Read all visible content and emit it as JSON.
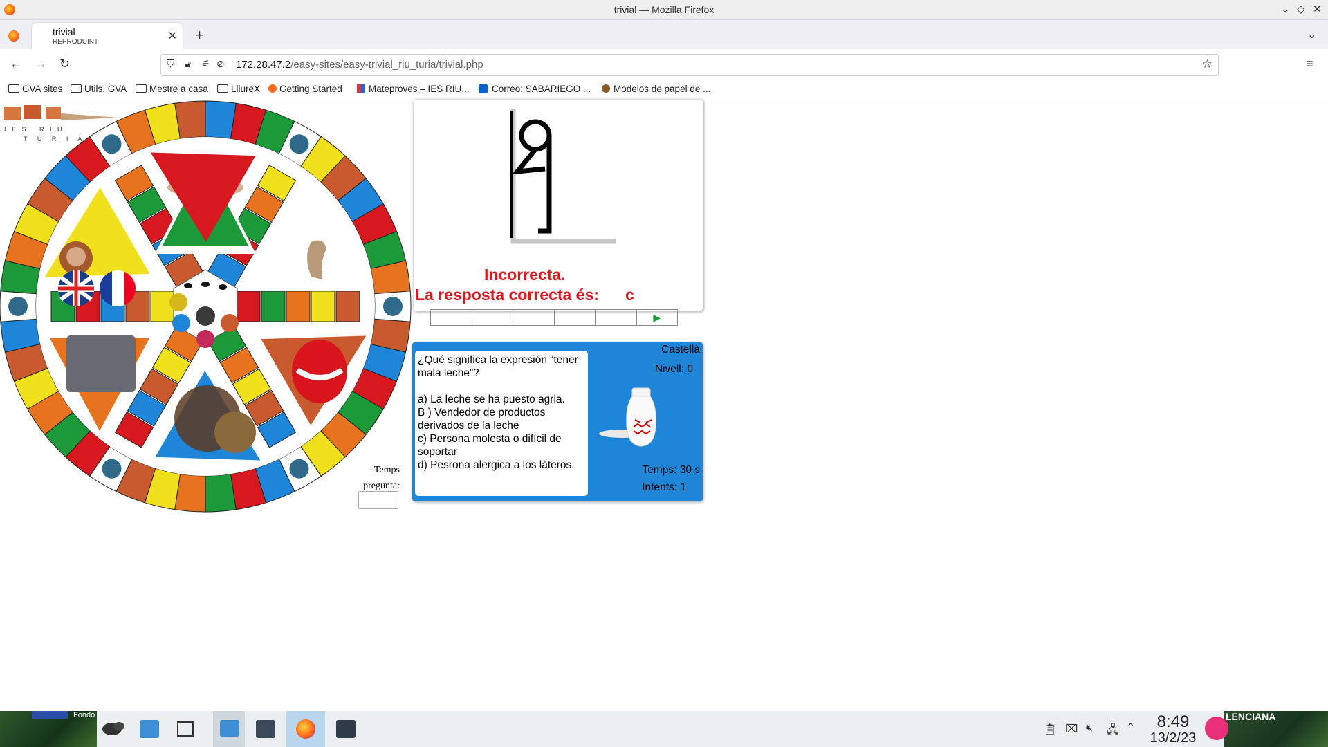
{
  "window": {
    "title": "trivial — Mozilla Firefox"
  },
  "tab": {
    "title": "trivial",
    "subtitle": "REPRODUINT"
  },
  "address": {
    "host": "172.28.47.2",
    "path": "/easy-sites/easy-trivial_riu_turia/trivial.php"
  },
  "bookmarks": [
    {
      "label": "GVA sites",
      "icon": "folder-icon"
    },
    {
      "label": "Utils. GVA",
      "icon": "folder-icon"
    },
    {
      "label": "Mestre a casa",
      "icon": "folder-icon"
    },
    {
      "label": "LliureX",
      "icon": "folder-icon"
    },
    {
      "label": "Getting Started",
      "icon": "firefox-icon"
    },
    {
      "label": "Mateproves – IES RIU...",
      "icon": "site-icon"
    },
    {
      "label": "Correo: SABARIEGO ...",
      "icon": "outlook-icon"
    },
    {
      "label": "Modelos de papel de ...",
      "icon": "site-icon"
    }
  ],
  "logo": {
    "line1": "I E S   R I U",
    "line2": "T Ú R I A"
  },
  "result": {
    "line1": "Incorrecta.",
    "line2": "La resposta correcta és:",
    "answer": "c"
  },
  "question": {
    "language": "Castellà",
    "level": "Nivell: 0",
    "text": "¿Qué significa la expresión “tener mala leche”?",
    "options": [
      "a) La leche se ha puesto agria.",
      "B ) Vendedor de productos derivados de la leche",
      "c) Persona molesta o difícil de soportar",
      "d) Pesrona alergica a los làteros."
    ],
    "time": "Temps: 30 s",
    "attempts": "Intents: 1"
  },
  "timer": {
    "label1": "Temps",
    "label2": "pregunta:"
  },
  "taskbar": {
    "time": "8:49",
    "date": "13/2/23",
    "wallpaper_text": "Fondo",
    "right_text": "LENCIANA"
  },
  "colors": {
    "red": "#e8141b",
    "panel_blue": "#1e86d9"
  }
}
